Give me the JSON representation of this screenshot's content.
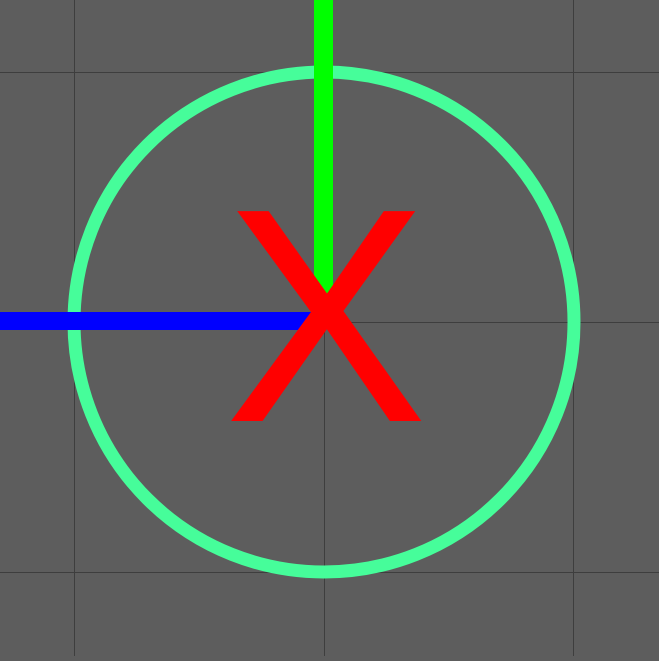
{
  "viewport": {
    "background_color": "#5d5d5d",
    "grid_line_color": "#3e3e3e",
    "gizmo": {
      "label": "X",
      "label_color": "#ff0000",
      "ring_color": "#46fd9a",
      "up_axis_color": "#00ff00",
      "left_axis_color": "#0000ff"
    }
  }
}
